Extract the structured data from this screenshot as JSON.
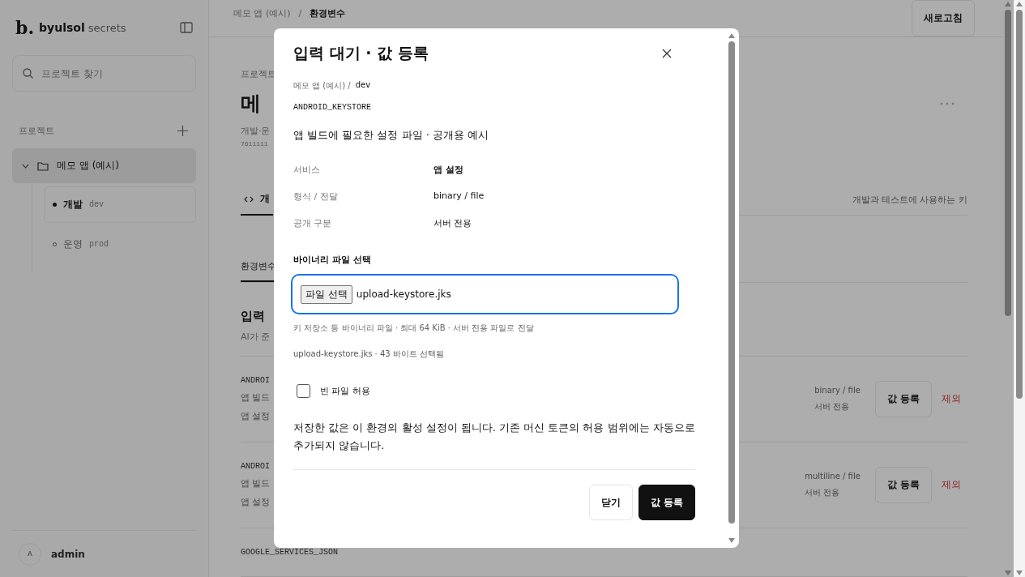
{
  "sidebar": {
    "logo_mark": "b.",
    "logo_name": "byulsol",
    "logo_sub": "secrets",
    "search": {
      "placeholder": "프로젝트 찾기"
    },
    "section_label": "프로젝트",
    "projects": [
      {
        "name": "메모 앱 (예시)",
        "expanded": true,
        "selected": true,
        "children": [
          {
            "name": "개발",
            "code": "dev",
            "selected": true
          },
          {
            "name": "운영",
            "code": "prod",
            "selected": false
          }
        ]
      }
    ],
    "user": {
      "initial": "A",
      "name": "admin"
    }
  },
  "main": {
    "breadcrumb": [
      "메모 앱 (예시)",
      "환경변수"
    ],
    "breadcrumb_separator": "/",
    "refresh_button": "새로고침",
    "eyebrow": "프로젝트",
    "title": "메",
    "subtitle": "개발·운",
    "project_id": "7611111",
    "tabs": [
      {
        "label": "개",
        "selected": true
      }
    ],
    "tab_caption": "개발과 테스트에 사용하는 키",
    "subtabs": [
      {
        "label": "환경변수",
        "selected": true
      }
    ],
    "section_title": "입력",
    "section_desc": "AI가 준",
    "rows": [
      {
        "key": "ANDROI",
        "desc": "앱 빌드",
        "service": "앱 설정",
        "format": "binary / file",
        "visibility": "서버 전용",
        "action": "값 등록",
        "remove": "제외"
      },
      {
        "key": "ANDROI",
        "desc": "앱 빌드",
        "service": "앱 설정",
        "format": "multiline / file",
        "visibility": "서버 전용",
        "action": "값 등록",
        "remove": "제외"
      },
      {
        "key": "GOOGLE_SERVICES_JSON"
      }
    ]
  },
  "dialog": {
    "title": "입력 대기 · 값 등록",
    "breadcrumb": "메모 앱 (예시) /",
    "env": "dev",
    "key": "ANDROID_KEYSTORE",
    "description": "앱 빌드에 필요한 설정 파일 · 공개용 예시",
    "details": [
      {
        "label": "서비스",
        "value": "앱 설정",
        "emphasis": true
      },
      {
        "label": "형식 / 전달",
        "value": "binary / file",
        "emphasis": false
      },
      {
        "label": "공개 구분",
        "value": "서버 전용",
        "emphasis": false
      }
    ],
    "file_field": {
      "label": "바이너리 파일 선택",
      "button": "파일 선택",
      "value": "upload-keystore.jks",
      "focused": true
    },
    "hint": "키 저장소 등 바이너리 파일 · 최대 64 KiB · 서버 전용 파일로 전달",
    "selected_info": "upload-keystore.jks · 43 바이트 선택됨",
    "checkbox": {
      "label": "빈 파일 허용",
      "checked": false
    },
    "note": "저장한 값은 이 환경의 활성 설정이 됩니다. 기존 머신 토큰의 허용 범위에는 자동으로 추가되지 않습니다.",
    "buttons": [
      {
        "label": "닫기",
        "kind": "secondary"
      },
      {
        "label": "값 등록",
        "kind": "primary"
      }
    ]
  }
}
